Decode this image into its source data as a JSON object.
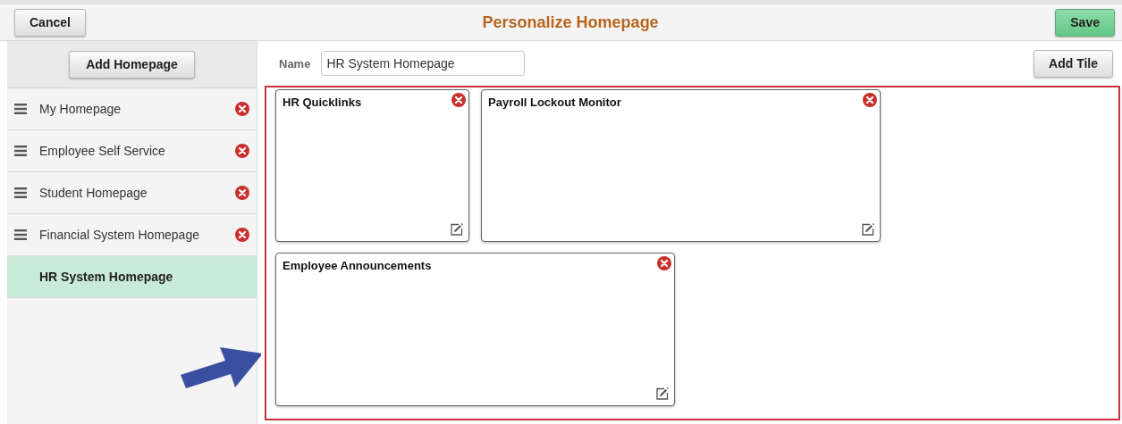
{
  "header": {
    "cancel": "Cancel",
    "title": "Personalize Homepage",
    "save": "Save"
  },
  "sidebar": {
    "add_button": "Add Homepage",
    "items": [
      {
        "label": "My Homepage",
        "selected": false
      },
      {
        "label": "Employee Self Service",
        "selected": false
      },
      {
        "label": "Student Homepage",
        "selected": false
      },
      {
        "label": "Financial System Homepage",
        "selected": false
      },
      {
        "label": "HR System Homepage",
        "selected": true
      }
    ]
  },
  "name_field": {
    "label": "Name",
    "value": "HR System Homepage"
  },
  "add_tile": "Add Tile",
  "tiles": [
    {
      "title": "HR Quicklinks",
      "kind": "single"
    },
    {
      "title": "Payroll Lockout Monitor",
      "kind": "double"
    },
    {
      "title": "Employee Announcements",
      "kind": "double"
    }
  ]
}
